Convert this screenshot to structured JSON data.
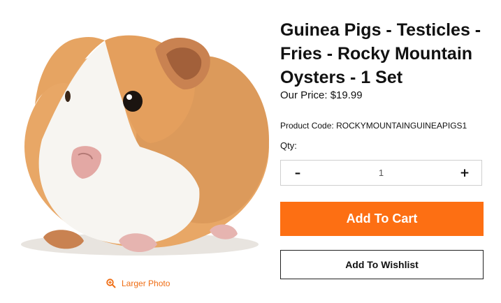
{
  "product": {
    "title": "Guinea Pigs - Testicles - Fries - Rocky Mountain Oysters - 1 Set",
    "price_label": "Our Price:",
    "price": "$19.99",
    "code_label": "Product Code:",
    "code": "ROCKYMOUNTAINGUINEAPIGS1",
    "photo_subject": "guinea pig"
  },
  "photo": {
    "larger_photo_label": "Larger Photo",
    "icon": "zoom-in-icon"
  },
  "quantity": {
    "label": "Qty:",
    "value": "1",
    "minus_symbol": "–",
    "plus_symbol": "+"
  },
  "actions": {
    "add_to_cart": "Add To Cart",
    "add_to_wishlist": "Add To Wishlist"
  },
  "colors": {
    "accent": "#fd6f13",
    "link": "#ef6c12"
  }
}
